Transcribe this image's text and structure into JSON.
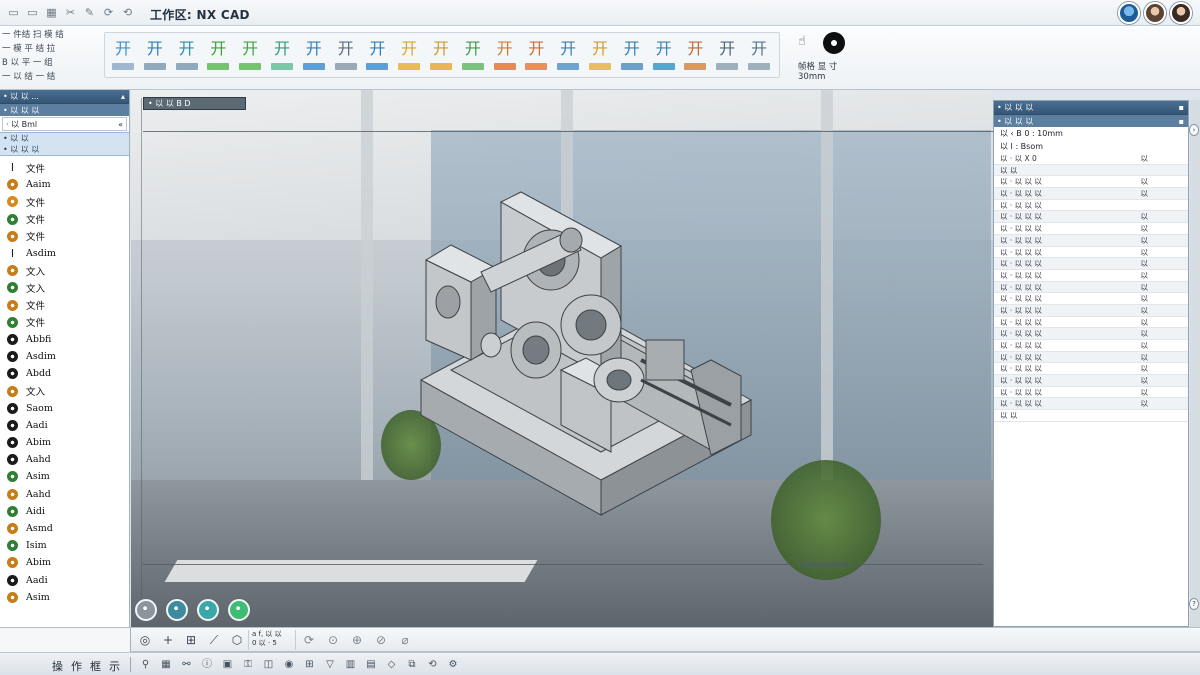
{
  "window": {
    "title": "工作区: NX CAD"
  },
  "quick_access": [
    {
      "icon": "document-icon",
      "glyph": "▭"
    },
    {
      "icon": "folder-icon",
      "glyph": "▭"
    },
    {
      "icon": "grid-icon",
      "glyph": "▦"
    },
    {
      "icon": "scissors-icon",
      "glyph": "✂"
    },
    {
      "icon": "brush-icon",
      "glyph": "✎"
    },
    {
      "icon": "redo-icon",
      "glyph": "⟳"
    },
    {
      "icon": "refresh-icon",
      "glyph": "⟲"
    }
  ],
  "ribbon": {
    "left_rows": [
      "一 件结 扫 模 结",
      "一 模 平 结 拉",
      "B 以 平 一 组",
      "一 以 结 一 结"
    ],
    "tools": [
      {
        "glyph": "开",
        "color": "#3d8fd6",
        "bar": "#9db8cf"
      },
      {
        "glyph": "开",
        "color": "#2e7cc2",
        "bar": "#8fa9bf"
      },
      {
        "glyph": "开",
        "color": "#2b8fa8",
        "bar": "#8fa9bf"
      },
      {
        "glyph": "开",
        "color": "#39a33b",
        "bar": "#74c46f"
      },
      {
        "glyph": "开",
        "color": "#3ea64a",
        "bar": "#74c46f"
      },
      {
        "glyph": "开",
        "color": "#2f9d7a",
        "bar": "#7bc8a6"
      },
      {
        "glyph": "开",
        "color": "#2b7fc4",
        "bar": "#5e9fd3"
      },
      {
        "glyph": "开",
        "color": "#5a6e80",
        "bar": "#9aa9b6"
      },
      {
        "glyph": "开",
        "color": "#2b7fc4",
        "bar": "#5e9fd3"
      },
      {
        "glyph": "开",
        "color": "#e0a12a",
        "bar": "#e9bb55"
      },
      {
        "glyph": "开",
        "color": "#d6952b",
        "bar": "#e7b655"
      },
      {
        "glyph": "开",
        "color": "#3c9b4b",
        "bar": "#7cc17e"
      },
      {
        "glyph": "开",
        "color": "#d87a2b",
        "bar": "#e28b5a"
      },
      {
        "glyph": "开",
        "color": "#d66a2a",
        "bar": "#e69060"
      },
      {
        "glyph": "开",
        "color": "#3a7fb8",
        "bar": "#6fa4cc"
      },
      {
        "glyph": "开",
        "color": "#d8982a",
        "bar": "#e8be5e"
      },
      {
        "glyph": "开",
        "color": "#2f7fbf",
        "bar": "#6e9fc7"
      },
      {
        "glyph": "开",
        "color": "#3683bf",
        "bar": "#58a6cf"
      },
      {
        "glyph": "开",
        "color": "#c56a2e",
        "bar": "#d79a62"
      },
      {
        "glyph": "开",
        "color": "#4f6677",
        "bar": "#9fb0bd"
      },
      {
        "glyph": "开",
        "color": "#56738a",
        "bar": "#9fb0bd"
      }
    ],
    "right_text_1": "帧格 显 寸",
    "right_text_2": "30mm"
  },
  "navigator": {
    "header": "• 以 以 ...",
    "subheader": "• 以 以 以",
    "field_label": "· 以 Bml",
    "field_chevron": "«",
    "selected_rows": [
      "• 以 以",
      "• 以 以 以"
    ],
    "items": [
      {
        "icon": "I-beam-icon",
        "label": "文件",
        "color": "#222222"
      },
      {
        "icon": "gear-icon",
        "label": "Aaim",
        "color": "#c77d18"
      },
      {
        "icon": "gear-icon",
        "label": "文件",
        "color": "#d8891c"
      },
      {
        "icon": "gear-icon",
        "label": "文件",
        "color": "#2f7f34"
      },
      {
        "icon": "gear-icon",
        "label": "文件",
        "color": "#c77d18"
      },
      {
        "icon": "I-beam-icon",
        "label": "Asdim",
        "color": "#222222"
      },
      {
        "icon": "gear-icon",
        "label": "文入",
        "color": "#c77d18"
      },
      {
        "icon": "gear-icon",
        "label": "文入",
        "color": "#2f7f34"
      },
      {
        "icon": "gear-icon",
        "label": "文件",
        "color": "#c77d18"
      },
      {
        "icon": "gear-icon",
        "label": "文件",
        "color": "#2f7f34"
      },
      {
        "icon": "gear-icon",
        "label": "Abbfi",
        "color": "#1b1b1b"
      },
      {
        "icon": "gear-icon",
        "label": "Asdim",
        "color": "#1b1b1b"
      },
      {
        "icon": "gear-icon",
        "label": "Abdd",
        "color": "#1b1b1b"
      },
      {
        "icon": "gear-icon",
        "label": "文入",
        "color": "#c77d18"
      },
      {
        "icon": "gear-icon",
        "label": "Saom",
        "color": "#1b1b1b"
      },
      {
        "icon": "gear-icon",
        "label": "Aadi",
        "color": "#1b1b1b"
      },
      {
        "icon": "gear-icon",
        "label": "Abim",
        "color": "#1b1b1b"
      },
      {
        "icon": "gear-icon",
        "label": "Aahd",
        "color": "#1b1b1b"
      },
      {
        "icon": "gear-icon",
        "label": "Asim",
        "color": "#2f7f34"
      },
      {
        "icon": "gear-icon",
        "label": "Aahd",
        "color": "#c77d18"
      },
      {
        "icon": "gear-icon",
        "label": "Aidi",
        "color": "#2f7f34"
      },
      {
        "icon": "gear-icon",
        "label": "Asmd",
        "color": "#c77d18"
      },
      {
        "icon": "gear-icon",
        "label": "Isim",
        "color": "#2f7f34"
      },
      {
        "icon": "gear-icon",
        "label": "Abim",
        "color": "#c77d18"
      },
      {
        "icon": "gear-icon",
        "label": "Aadi",
        "color": "#1b1b1b"
      },
      {
        "icon": "gear-icon",
        "label": "Asim",
        "color": "#c77d18"
      }
    ]
  },
  "viewport": {
    "label": "• 以 以 B D",
    "snap_buttons": [
      {
        "icon": "snap-circle-icon",
        "color": "#8a959d"
      },
      {
        "icon": "snap-target-icon",
        "color": "#3d8b9d"
      },
      {
        "icon": "snap-sphere-icon",
        "color": "#3aa7a8"
      },
      {
        "icon": "snap-point-icon",
        "color": "#3dbd73"
      }
    ]
  },
  "properties": {
    "header": "• 以 以 以",
    "subheader": "• 以 以 以",
    "info_1": "以 ‹  B 0 : 10mm",
    "info_2": "以  I : Bsom",
    "rows": [
      {
        "label": "以 · 以 X 0",
        "value": "以"
      },
      {
        "label": "以 以",
        "value": ""
      },
      {
        "label": "以 · 以 以 以",
        "value": "以"
      },
      {
        "label": "以 · 以 以 以",
        "value": "以"
      },
      {
        "label": "以 · 以 以 以",
        "value": ""
      },
      {
        "label": "以 · 以 以 以",
        "value": "以"
      },
      {
        "label": "以 · 以 以 以",
        "value": "以"
      },
      {
        "label": "以 · 以 以 以",
        "value": "以"
      },
      {
        "label": "以 · 以 以 以",
        "value": "以"
      },
      {
        "label": "以 · 以 以 以",
        "value": "以"
      },
      {
        "label": "以 · 以 以 以",
        "value": "以"
      },
      {
        "label": "以 · 以 以 以",
        "value": "以"
      },
      {
        "label": "以 · 以 以 以",
        "value": "以"
      },
      {
        "label": "以 · 以 以 以",
        "value": "以"
      },
      {
        "label": "以 · 以 以 以",
        "value": "以"
      },
      {
        "label": "以 · 以 以 以",
        "value": "以"
      },
      {
        "label": "以 · 以 以 以",
        "value": "以"
      },
      {
        "label": "以 · 以 以 以",
        "value": "以"
      },
      {
        "label": "以 · 以 以 以",
        "value": "以"
      },
      {
        "label": "以 · 以 以 以",
        "value": "以"
      },
      {
        "label": "以 · 以 以 以",
        "value": "以"
      },
      {
        "label": "以 · 以 以 以",
        "value": "以"
      },
      {
        "label": "以 以",
        "value": ""
      }
    ]
  },
  "bottom_toolbar": {
    "tools": [
      {
        "icon": "snap-circle-icon",
        "glyph": "◎"
      },
      {
        "icon": "crosshair-icon",
        "glyph": "+"
      },
      {
        "icon": "measure-icon",
        "glyph": "⊞"
      },
      {
        "icon": "line-icon",
        "glyph": "⟋"
      },
      {
        "icon": "select-icon",
        "glyph": "⬡"
      }
    ],
    "coord_line_1": "a f, 以 以",
    "coord_line_2": "0 以 · 5",
    "view_tools": [
      {
        "icon": "rotate-icon",
        "glyph": "⟳"
      },
      {
        "icon": "pan-icon",
        "glyph": "⊙"
      },
      {
        "icon": "zoom-icon",
        "glyph": "⊕"
      },
      {
        "icon": "fit-icon",
        "glyph": "⊘"
      },
      {
        "icon": "section-icon",
        "glyph": "⌀"
      }
    ]
  },
  "status": {
    "labels": [
      "操",
      "作",
      "框",
      "示"
    ],
    "icons": [
      {
        "icon": "pin-icon",
        "glyph": "⚲"
      },
      {
        "icon": "grid-icon",
        "glyph": "▦"
      },
      {
        "icon": "link-icon",
        "glyph": "⚯"
      },
      {
        "icon": "info-icon",
        "glyph": "ⓘ"
      },
      {
        "icon": "save-icon",
        "glyph": "▣"
      },
      {
        "icon": "lock-icon",
        "glyph": "⚿"
      },
      {
        "icon": "layer-icon",
        "glyph": "◫"
      },
      {
        "icon": "camera-icon",
        "glyph": "◉"
      },
      {
        "icon": "measure-icon",
        "glyph": "⊞"
      },
      {
        "icon": "filter-icon",
        "glyph": "▽"
      },
      {
        "icon": "chart-icon",
        "glyph": "▥"
      },
      {
        "icon": "table-icon",
        "glyph": "▤"
      },
      {
        "icon": "tag-icon",
        "glyph": "◇"
      },
      {
        "icon": "copy-icon",
        "glyph": "⧉"
      },
      {
        "icon": "history-icon",
        "glyph": "⟲"
      },
      {
        "icon": "settings-icon",
        "glyph": "⚙"
      }
    ]
  }
}
